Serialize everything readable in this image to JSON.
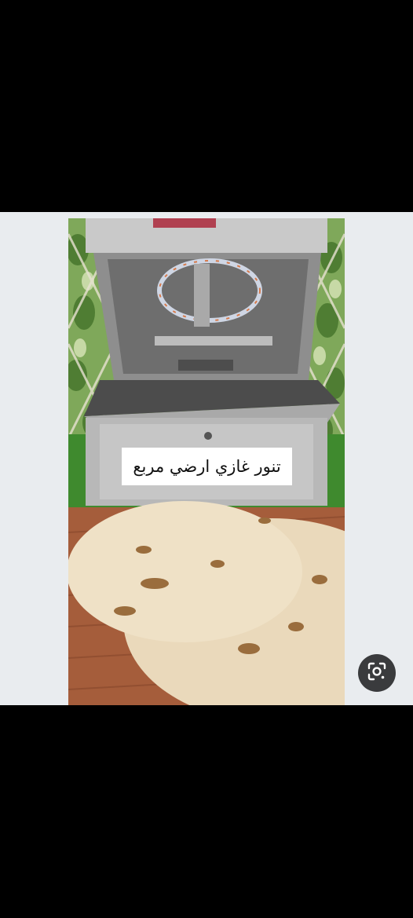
{
  "overlay": {
    "caption": "تنور غازي ارضي مربع"
  },
  "controls": {
    "lens_icon": "google-lens-icon"
  },
  "colors": {
    "background": "#000000",
    "viewer_bg": "#e9ecef",
    "lens_button": "#3a3b3d"
  }
}
